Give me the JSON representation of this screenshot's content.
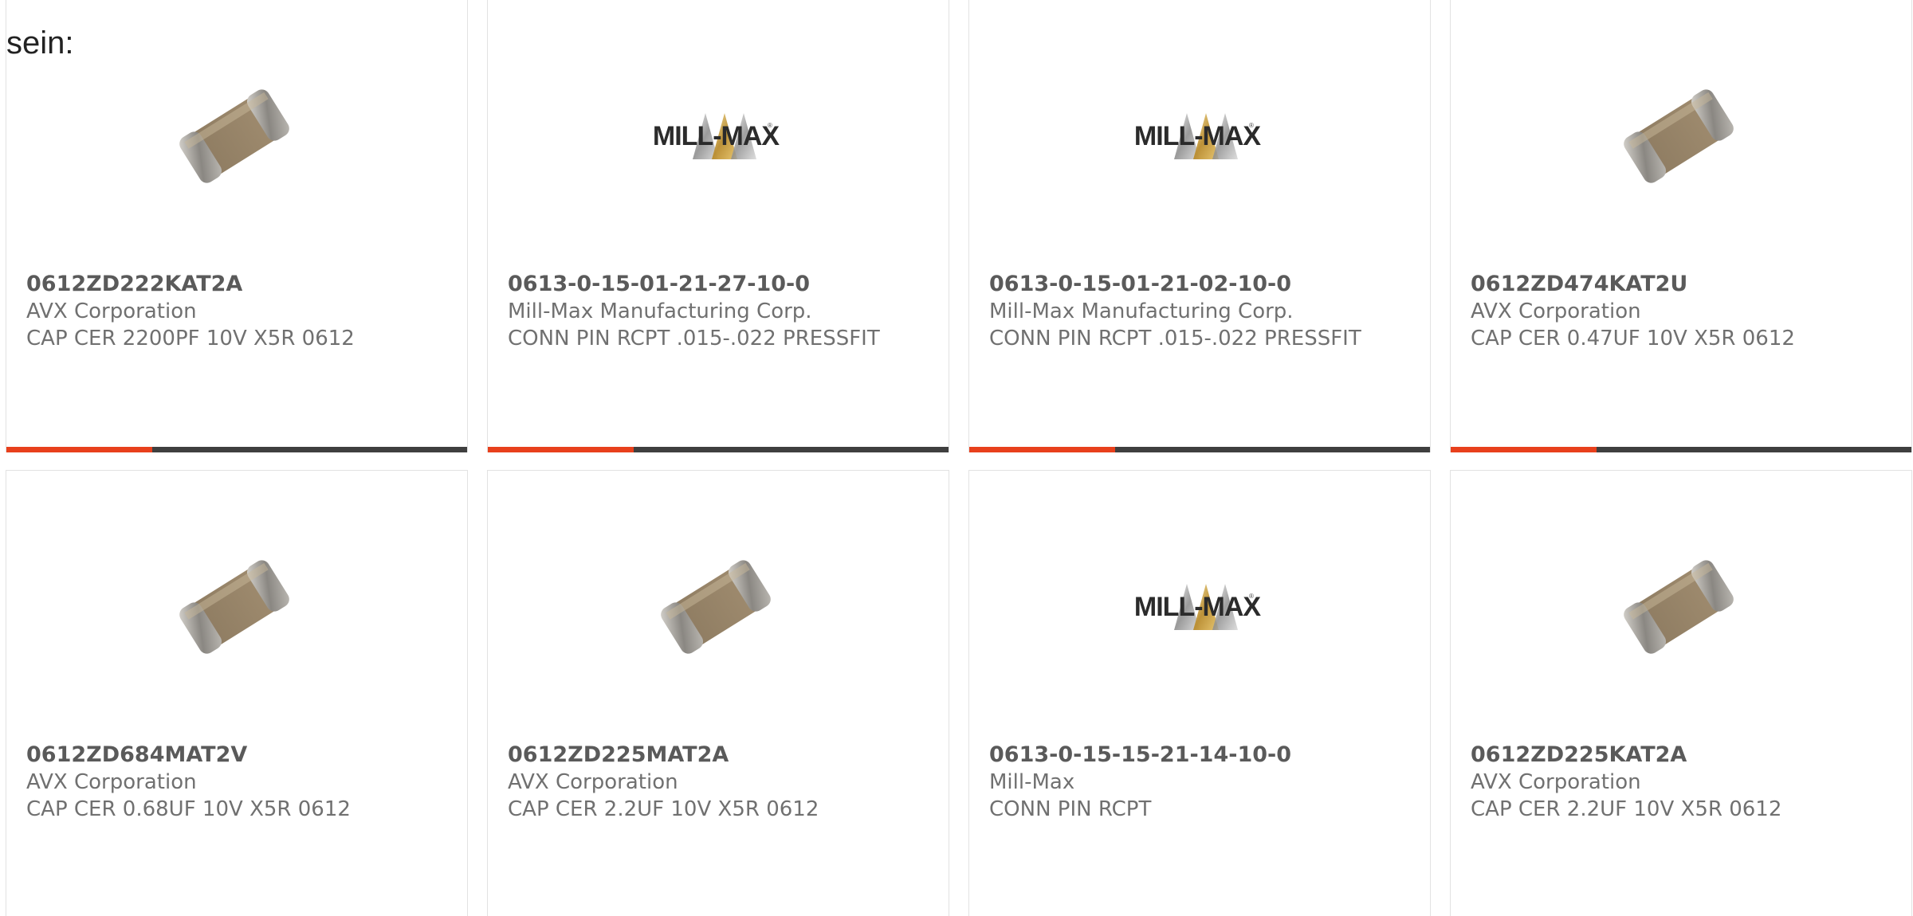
{
  "intro_text": "sein:",
  "accent_color": "#e8401c",
  "bar_color": "#3f3f3f",
  "products": [
    {
      "part_number": "0612ZD222KAT2A",
      "manufacturer": "AVX Corporation",
      "description": "CAP CER 2200PF 10V X5R 0612",
      "image": "capacitor-chip",
      "show_bar": true
    },
    {
      "part_number": "0613-0-15-01-21-27-10-0",
      "manufacturer": "Mill-Max Manufacturing Corp.",
      "description": "CONN PIN RCPT .015-.022 PRESSFIT",
      "image": "mill-max-logo",
      "logo_text": "MILL-MAX",
      "show_bar": true
    },
    {
      "part_number": "0613-0-15-01-21-02-10-0",
      "manufacturer": "Mill-Max Manufacturing Corp.",
      "description": "CONN PIN RCPT .015-.022 PRESSFIT",
      "image": "mill-max-logo",
      "logo_text": "MILL-MAX",
      "show_bar": true
    },
    {
      "part_number": "0612ZD474KAT2U",
      "manufacturer": "AVX Corporation",
      "description": "CAP CER 0.47UF 10V X5R 0612",
      "image": "capacitor-chip",
      "show_bar": true
    },
    {
      "part_number": "0612ZD684MAT2V",
      "manufacturer": "AVX Corporation",
      "description": "CAP CER 0.68UF 10V X5R 0612",
      "image": "capacitor-chip",
      "show_bar": false
    },
    {
      "part_number": "0612ZD225MAT2A",
      "manufacturer": "AVX Corporation",
      "description": "CAP CER 2.2UF 10V X5R 0612",
      "image": "capacitor-chip",
      "show_bar": false
    },
    {
      "part_number": "0613-0-15-15-21-14-10-0",
      "manufacturer": "Mill-Max",
      "description": "CONN PIN RCPT",
      "image": "mill-max-logo",
      "logo_text": "MILL-MAX",
      "show_bar": false
    },
    {
      "part_number": "0612ZD225KAT2A",
      "manufacturer": "AVX Corporation",
      "description": "CAP CER 2.2UF 10V X5R 0612",
      "image": "capacitor-chip",
      "show_bar": false
    }
  ]
}
